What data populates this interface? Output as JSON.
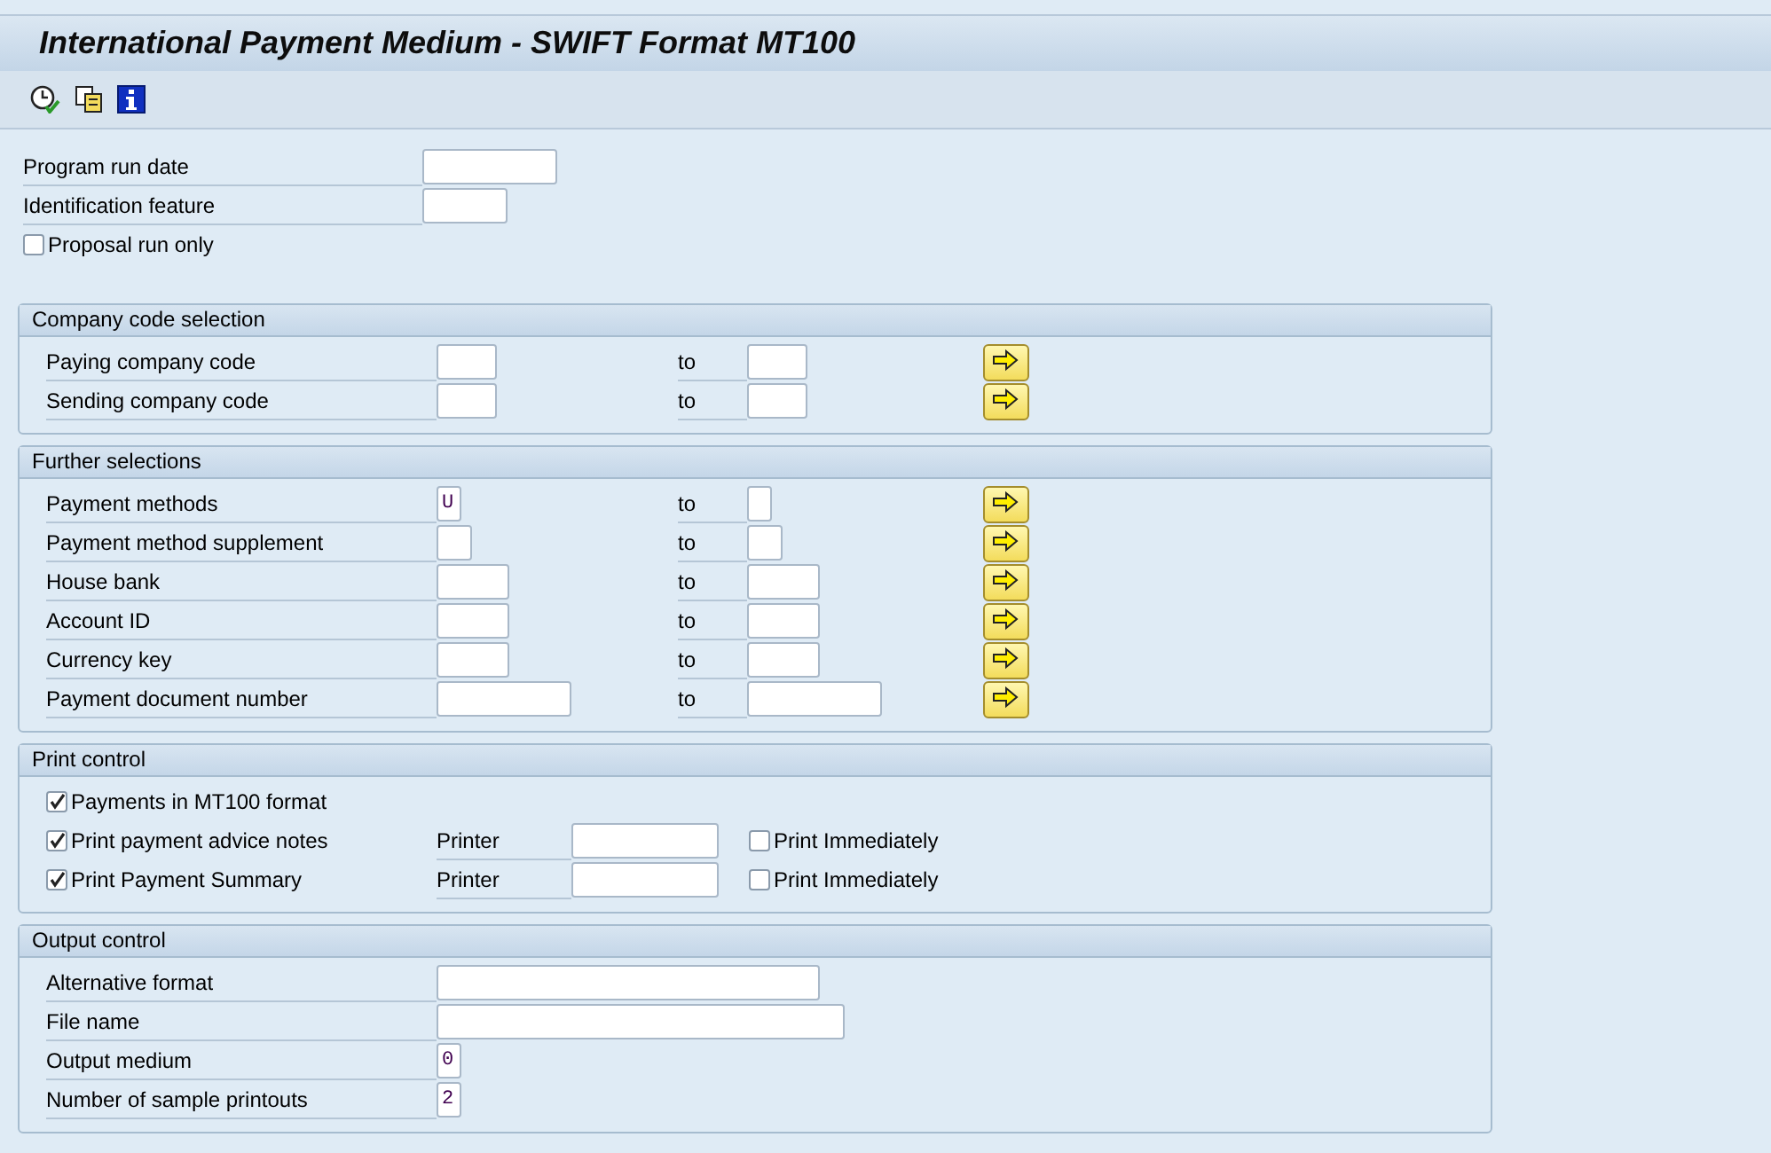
{
  "window": {
    "title": "International Payment Medium - SWIFT Format MT100"
  },
  "top_fields": [
    {
      "kind": "field",
      "label": "Program run date"
    },
    {
      "kind": "field",
      "label": "Identification feature"
    },
    {
      "kind": "checkbox",
      "label": "Proposal run only",
      "checked": false
    }
  ],
  "groups": [
    {
      "title": "Company code selection",
      "rows": [
        {
          "kind": "range",
          "label": "Paying company code",
          "to_label": "to"
        },
        {
          "kind": "range",
          "label": "Sending company code",
          "to_label": "to"
        }
      ]
    },
    {
      "title": "Further selections",
      "rows": [
        {
          "kind": "range",
          "label": "Payment methods",
          "value": "U",
          "to_label": "to"
        },
        {
          "kind": "range",
          "label": "Payment method supplement",
          "to_label": "to"
        },
        {
          "kind": "range",
          "label": "House bank",
          "to_label": "to"
        },
        {
          "kind": "range",
          "label": "Account ID",
          "to_label": "to"
        },
        {
          "kind": "range",
          "label": "Currency key",
          "to_label": "to"
        },
        {
          "kind": "range",
          "label": "Payment document number",
          "to_label": "to"
        }
      ]
    },
    {
      "title": "Print control",
      "rows": [
        {
          "kind": "checkbox",
          "label": "Payments in MT100 format",
          "checked": true
        },
        {
          "kind": "printer",
          "label": "Print payment advice notes",
          "checked": true,
          "printer_label": "Printer",
          "immediate": {
            "label": "Print Immediately",
            "checked": false
          }
        },
        {
          "kind": "printer",
          "label": "Print Payment Summary",
          "checked": true,
          "printer_label": "Printer",
          "immediate": {
            "label": "Print Immediately",
            "checked": false
          }
        }
      ]
    },
    {
      "title": "Output control",
      "rows": [
        {
          "kind": "field",
          "label": "Alternative format"
        },
        {
          "kind": "field",
          "label": "File name"
        },
        {
          "kind": "field",
          "label": "Output medium",
          "value": "0"
        },
        {
          "kind": "field",
          "label": "Number of sample printouts",
          "value": "2"
        }
      ]
    }
  ]
}
